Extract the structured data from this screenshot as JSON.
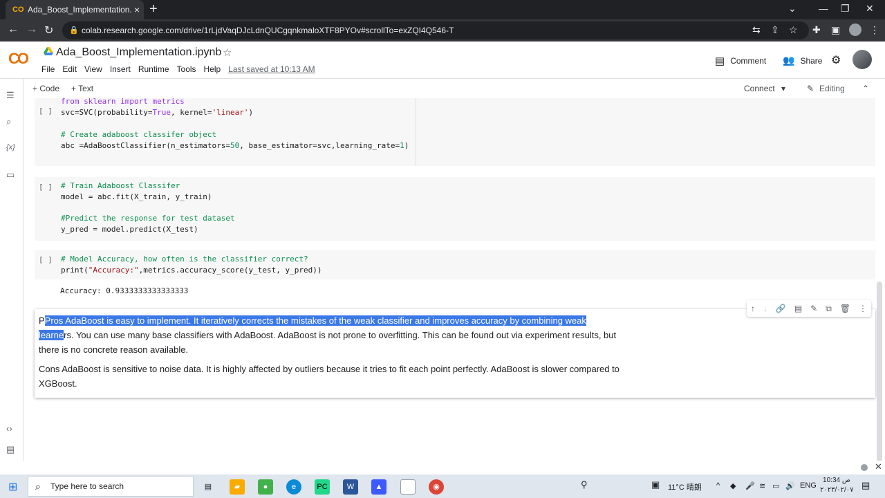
{
  "browser": {
    "tab_title": "Ada_Boost_Implementation.ipynb",
    "tab_favicon": "CO",
    "url": "colab.research.google.com/drive/1rLjdVaqDJcLdnQUCgqnkmaloXTF8PYOv#scrollTo=exZQI4Q546-T"
  },
  "colab": {
    "logo": "CO",
    "title": "Ada_Boost_Implementation.ipynb",
    "menu": [
      "File",
      "Edit",
      "View",
      "Insert",
      "Runtime",
      "Tools",
      "Help"
    ],
    "last_saved": "Last saved at 10:13 AM",
    "comment": "Comment",
    "share": "Share"
  },
  "toolbar": {
    "add_code": "+ Code",
    "add_text": "+ Text",
    "connect": "Connect",
    "editing": "Editing"
  },
  "cells": {
    "cell1_line1": "from sklearn import metrics",
    "cell1_line2_a": "svc=SVC(probability=",
    "cell1_line2_b": "True",
    "cell1_line2_c": ", kernel=",
    "cell1_line2_d": "'linear'",
    "cell1_line2_e": ")",
    "cell1_comment": "# Create adaboost classifer object",
    "cell1_line4_a": "abc =AdaBoostClassifier(n_estimators=",
    "cell1_line4_b": "50",
    "cell1_line4_c": ", base_estimator=svc,learning_rate=",
    "cell1_line4_d": "1",
    "cell1_line4_e": ")",
    "cell2_comment1": "# Train Adaboost Classifer",
    "cell2_line2": "model = abc.fit(X_train, y_train)",
    "cell2_comment2": "#Predict the response for test dataset",
    "cell2_line4": "y_pred = model.predict(X_test)",
    "cell3_comment": "# Model Accuracy, how often is the classifier correct?",
    "cell3_line2_a": "print(",
    "cell3_line2_b": "\"Accuracy:\"",
    "cell3_line2_c": ",metrics.accuracy_score(y_test, y_pred))",
    "output": "Accuracy: 0.9333333333333333",
    "gutter": "[ ]"
  },
  "markdown": {
    "p1_hl1": "Pros AdaBoost is easy to implement. It iteratively corrects the mistakes of the weak classifier and improves accuracy by combining weak",
    "p1_hl2": "learne",
    "p1_rest": "rs. You can use many base classifiers with AdaBoost. AdaBoost is not prone to overfitting. This can be found out via experiment results, but there is no concrete reason available.",
    "p2": "Cons AdaBoost is sensitive to noise data. It is highly affected by outliers because it tries to fit each point perfectly. AdaBoost is slower compared to XGBoost."
  },
  "taskbar": {
    "search_placeholder": "Type here to search",
    "weather": "11°C 晴朗",
    "lang": "ENG",
    "time": "10:34 ص",
    "date": "٢٠٢٣/٠٢/٠٧"
  }
}
